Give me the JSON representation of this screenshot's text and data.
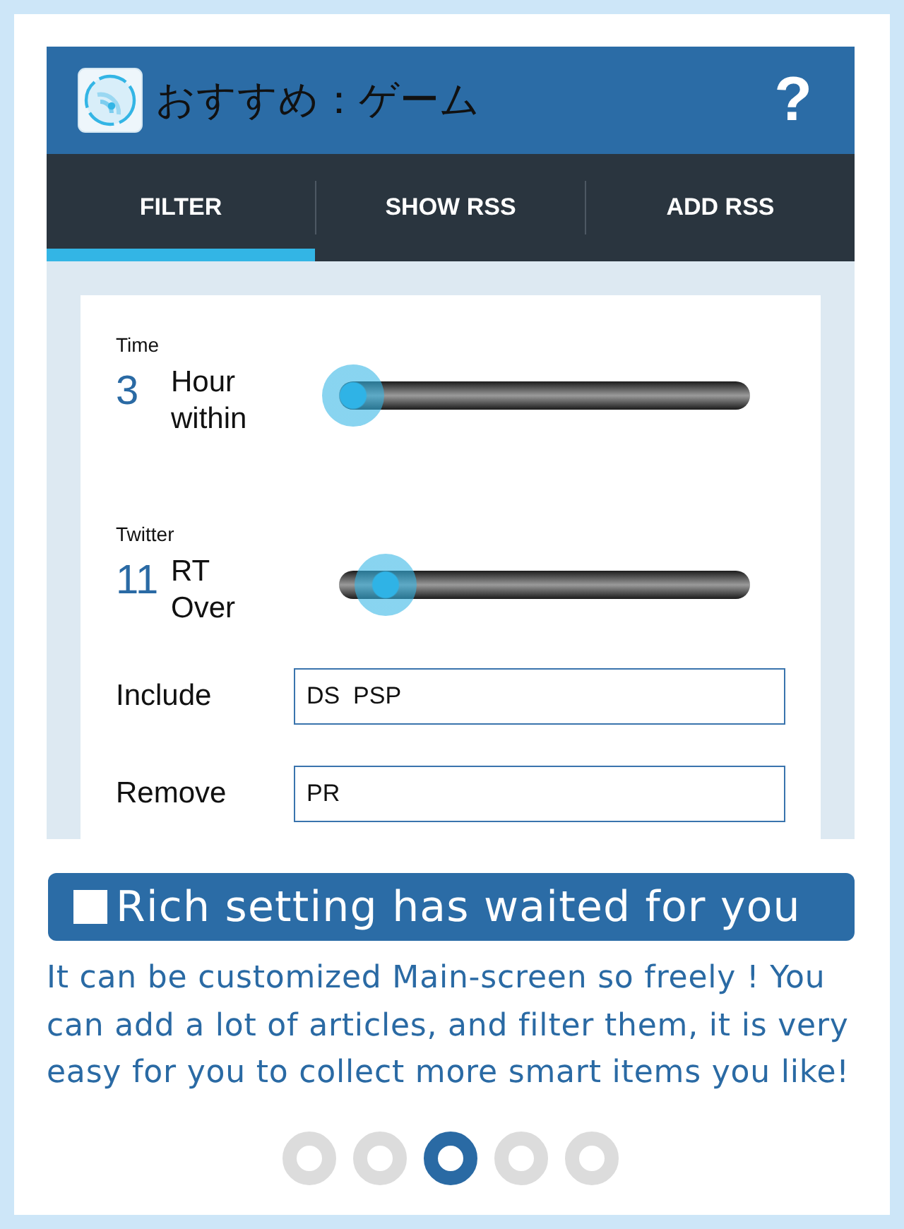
{
  "app_bar": {
    "title": "おすすめ：ゲーム",
    "help": "?"
  },
  "tabs": [
    {
      "label": "FILTER",
      "selected": true
    },
    {
      "label": "SHOW RSS",
      "selected": false
    },
    {
      "label": "ADD RSS",
      "selected": false
    }
  ],
  "sliders": [
    {
      "caption": "Time",
      "value": "3",
      "unit": "Hour within",
      "level": 0
    },
    {
      "caption": "Twitter",
      "value": "11",
      "unit": "RT Over",
      "level": 0.085
    }
  ],
  "fields": [
    {
      "label": "Include",
      "value": "DS  PSP"
    },
    {
      "label": "Remove",
      "value": "PR"
    }
  ],
  "banner": {
    "title": "Rich setting has waited for you"
  },
  "description": "It can be customized Main-screen so freely ! You can add a lot of articles, and filter them, it is very easy for you to collect more smart items you like!",
  "pager": [
    {
      "selected": false
    },
    {
      "selected": false
    },
    {
      "selected": true
    },
    {
      "selected": false
    },
    {
      "selected": false
    }
  ]
}
